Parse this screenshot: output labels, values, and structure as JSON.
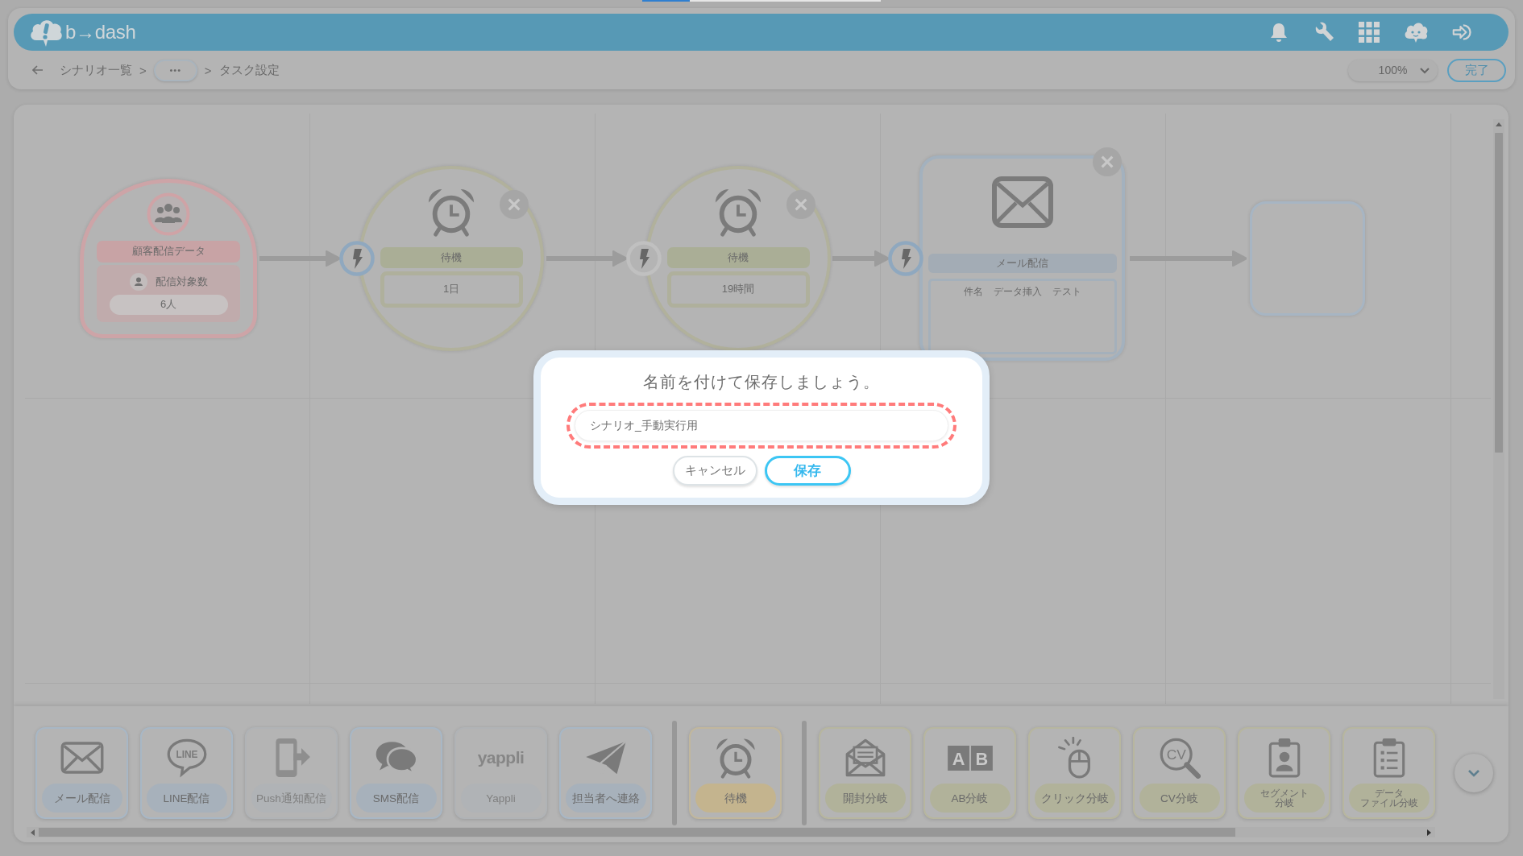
{
  "progress_bar": {
    "level": 0.2
  },
  "header": {
    "logo": "b→dash"
  },
  "breadcrumb": [
    {
      "kind": "link",
      "label": "シナリオ一覧"
    },
    {
      "kind": "separator",
      "label": ">"
    },
    {
      "kind": "more",
      "label": "•••"
    },
    {
      "kind": "separator",
      "label": ">"
    },
    {
      "kind": "current",
      "label": "タスク設定"
    }
  ],
  "zoom_select": {
    "value": "100%"
  },
  "done_button": {
    "label": "完了"
  },
  "canvas": {
    "nodes": [
      {
        "kind": "segment",
        "label": "顧客配信データ",
        "count_label": "配信対象数",
        "count": "6人"
      },
      {
        "kind": "wait",
        "label": "待機",
        "value": "1日",
        "closable": true,
        "trigger": {
          "highlighted": true
        }
      },
      {
        "kind": "wait",
        "label": "待機",
        "value": "19時間",
        "closable": true,
        "trigger": {
          "highlighted": false
        }
      },
      {
        "kind": "mail",
        "label": "メール配信",
        "subject": [
          "件名",
          "データ挿入",
          "テスト"
        ],
        "closable": true,
        "trigger": {
          "highlighted": true
        }
      },
      {
        "kind": "empty"
      }
    ]
  },
  "palette": {
    "groups": [
      {
        "kind": "delivery",
        "items": [
          {
            "kind": "mail",
            "lines": [
              "メール配信"
            ],
            "disabled": false
          },
          {
            "kind": "line",
            "lines": [
              "LINE配信"
            ],
            "icon_text": [
              "LINE"
            ],
            "disabled": false
          },
          {
            "kind": "push",
            "lines": [
              "Push通知配信"
            ],
            "disabled": true
          },
          {
            "kind": "sms",
            "lines": [
              "SMS配信"
            ],
            "disabled": false
          },
          {
            "kind": "yappli",
            "lines": [
              "Yappli"
            ],
            "icon_text": [
              "yappli"
            ],
            "disabled": true
          },
          {
            "kind": "contact",
            "lines": [
              "担当者へ連絡"
            ],
            "disabled": false
          }
        ]
      },
      {
        "kind": "wait",
        "items": [
          {
            "kind": "wait",
            "lines": [
              "待機"
            ],
            "disabled": false
          }
        ]
      },
      {
        "kind": "branch",
        "items": [
          {
            "kind": "open",
            "lines": [
              "開封分岐"
            ],
            "disabled": false
          },
          {
            "kind": "ab",
            "lines": [
              "AB分岐"
            ],
            "icon_text": [
              "A",
              "B"
            ],
            "disabled": false
          },
          {
            "kind": "click",
            "lines": [
              "クリック分岐"
            ],
            "disabled": false
          },
          {
            "kind": "cv",
            "lines": [
              "CV分岐"
            ],
            "icon_text": [
              "CV"
            ],
            "disabled": false
          },
          {
            "kind": "segment",
            "lines": [
              "セグメント",
              "分岐"
            ],
            "disabled": false
          },
          {
            "kind": "datafile",
            "lines": [
              "データ",
              "ファイル分岐"
            ],
            "disabled": false
          }
        ]
      }
    ]
  },
  "dialog": {
    "title": "名前を付けて保存しましょう。",
    "name_field": {
      "value": "シナリオ_手動実行用",
      "highlighted": true
    },
    "buttons": [
      {
        "kind": "secondary",
        "label": "キャンセル"
      },
      {
        "kind": "primary",
        "label": "保存"
      }
    ]
  }
}
